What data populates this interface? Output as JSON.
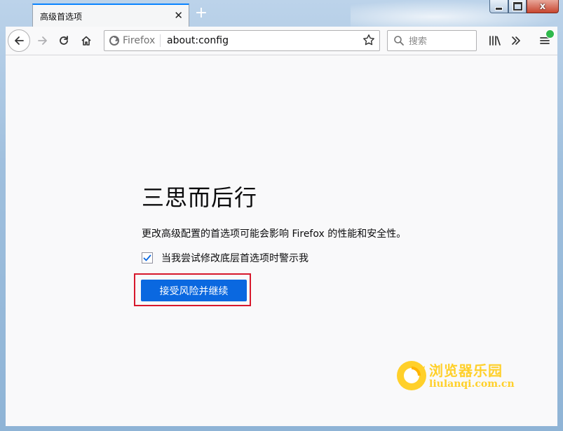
{
  "tab": {
    "title": "高级首选项",
    "close_symbol": "✕"
  },
  "new_tab_symbol": "+",
  "window_controls": {
    "close_symbol": "x"
  },
  "toolbar": {
    "identity_label": "Firefox",
    "url": "about:config",
    "search_placeholder": "搜索"
  },
  "warning": {
    "title": "三思而后行",
    "description": "更改高级配置的首选项可能会影响 Firefox 的性能和安全性。",
    "checkbox_label": "当我尝试修改底层首选项时警示我",
    "checkbox_checked": true,
    "accept_button": "接受风险并继续"
  },
  "watermark": {
    "name": "浏览器乐园",
    "url": "liulanqi.com.cn"
  },
  "colors": {
    "accent": "#0a68e0",
    "highlight": "#d7182c",
    "watermark": "#ffd02a",
    "update": "#30b94d"
  }
}
